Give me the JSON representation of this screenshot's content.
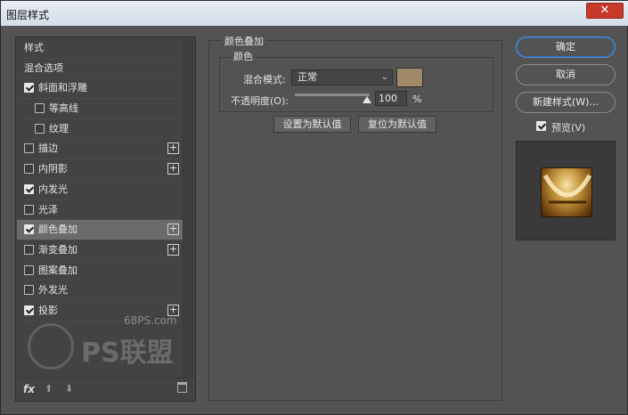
{
  "window": {
    "title": "图层样式",
    "close": "✕"
  },
  "left_panel": {
    "items": [
      {
        "label": "样式",
        "checkbox": false,
        "indent": 0,
        "plus": false,
        "selected": false
      },
      {
        "label": "混合选项",
        "checkbox": false,
        "indent": 0,
        "plus": false,
        "selected": false
      },
      {
        "label": "斜面和浮雕",
        "checkbox": true,
        "checked": true,
        "indent": 0,
        "plus": false,
        "selected": false
      },
      {
        "label": "等高线",
        "checkbox": true,
        "checked": false,
        "indent": 1,
        "plus": false,
        "selected": false
      },
      {
        "label": "纹理",
        "checkbox": true,
        "checked": false,
        "indent": 1,
        "plus": false,
        "selected": false
      },
      {
        "label": "描边",
        "checkbox": true,
        "checked": false,
        "indent": 0,
        "plus": true,
        "selected": false
      },
      {
        "label": "内阴影",
        "checkbox": true,
        "checked": false,
        "indent": 0,
        "plus": true,
        "selected": false
      },
      {
        "label": "内发光",
        "checkbox": true,
        "checked": true,
        "indent": 0,
        "plus": false,
        "selected": false
      },
      {
        "label": "光泽",
        "checkbox": true,
        "checked": false,
        "indent": 0,
        "plus": false,
        "selected": false
      },
      {
        "label": "颜色叠加",
        "checkbox": true,
        "checked": true,
        "indent": 0,
        "plus": true,
        "selected": true
      },
      {
        "label": "渐变叠加",
        "checkbox": true,
        "checked": false,
        "indent": 0,
        "plus": true,
        "selected": false
      },
      {
        "label": "图案叠加",
        "checkbox": true,
        "checked": false,
        "indent": 0,
        "plus": false,
        "selected": false
      },
      {
        "label": "外发光",
        "checkbox": true,
        "checked": false,
        "indent": 0,
        "plus": false,
        "selected": false
      },
      {
        "label": "投影",
        "checkbox": true,
        "checked": true,
        "indent": 0,
        "plus": true,
        "selected": false
      }
    ],
    "footer": {
      "fx": "fx",
      "up": "⬆",
      "down": "⬇",
      "trash_icon": "trash-icon"
    }
  },
  "color_overlay": {
    "section_title": "颜色叠加",
    "subsection_title": "颜色",
    "blend_mode_label": "混合模式:",
    "blend_mode_value": "正常",
    "color": "#a08a68",
    "opacity_label": "不透明度(O):",
    "opacity_value": "100",
    "opacity_unit": "%",
    "opacity_level": 1.0,
    "set_default": "设置为默认值",
    "reset_default": "复位为默认值"
  },
  "right_panel": {
    "ok": "确定",
    "cancel": "取消",
    "new_style": "新建样式(W)...",
    "preview_label": "预览(V)",
    "preview_checked": true
  },
  "watermark": {
    "site": "68PS.com",
    "brand": "PS联盟"
  }
}
